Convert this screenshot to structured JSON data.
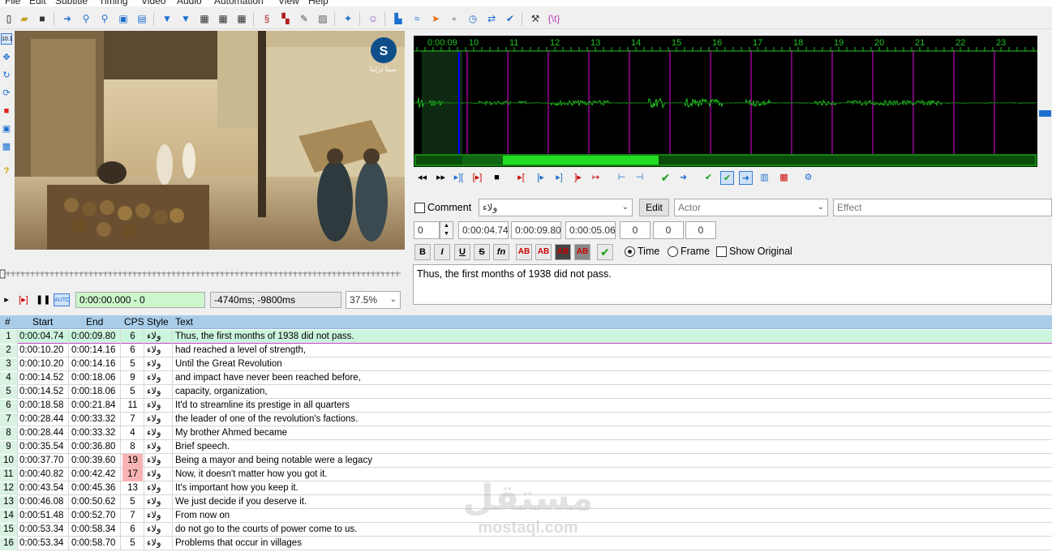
{
  "menu": [
    "File",
    "Edit",
    "Subtitle",
    "Timing",
    "Video",
    "Audio",
    "Automation",
    "View",
    "Help"
  ],
  "video": {
    "logo_text": "سما دراما",
    "position": "0:00:00.000 - 0",
    "offset": "-4740ms; -9800ms",
    "zoom": "37.5%"
  },
  "audio": {
    "time_labels": [
      "0:00:09",
      "10",
      "11",
      "12",
      "13",
      "14",
      "15",
      "16",
      "17",
      "18",
      "19",
      "20",
      "21",
      "22",
      "23"
    ],
    "colors": {
      "background": "#000000",
      "waveform": "#22c422",
      "boundary": "#e600e6",
      "cursor": "#0000ff"
    }
  },
  "editor": {
    "comment_label": "Comment",
    "style_value": "ولاء",
    "edit_label": "Edit",
    "actor_placeholder": "Actor",
    "effect_placeholder": "Effect",
    "layer": "0",
    "start": "0:00:04.74",
    "end": "0:00:09.80",
    "duration": "0:00:05.06",
    "margin_l": "0",
    "margin_r": "0",
    "margin_v": "0",
    "time_label": "Time",
    "frame_label": "Frame",
    "show_original_label": "Show Original",
    "text": "Thus, the first months of 1938 did not pass."
  },
  "grid": {
    "headers": {
      "num": "#",
      "start": "Start",
      "end": "End",
      "cps": "CPS",
      "style": "Style",
      "text": "Text"
    },
    "rows": [
      {
        "num": "1",
        "start": "0:00:04.74",
        "end": "0:00:09.80",
        "cps": "6",
        "style": "ولاء",
        "text": "Thus, the first months of 1938 did not pass."
      },
      {
        "num": "2",
        "start": "0:00:10.20",
        "end": "0:00:14.16",
        "cps": "6",
        "style": "ولاء",
        "text": " had reached a level of strength,"
      },
      {
        "num": "3",
        "start": "0:00:10.20",
        "end": "0:00:14.16",
        "cps": "5",
        "style": "ولاء",
        "text": "Until the Great Revolution"
      },
      {
        "num": "4",
        "start": "0:00:14.52",
        "end": "0:00:18.06",
        "cps": "9",
        "style": "ولاء",
        "text": "and impact have never been reached before,"
      },
      {
        "num": "5",
        "start": "0:00:14.52",
        "end": "0:00:18.06",
        "cps": "5",
        "style": "ولاء",
        "text": "capacity, organization,"
      },
      {
        "num": "6",
        "start": "0:00:18.58",
        "end": "0:00:21.84",
        "cps": "11",
        "style": "ولاء",
        "text": "It'd to streamline its prestige in all quarters"
      },
      {
        "num": "7",
        "start": "0:00:28.44",
        "end": "0:00:33.32",
        "cps": "7",
        "style": "ولاء",
        "text": "the leader of one of the revolution's factions."
      },
      {
        "num": "8",
        "start": "0:00:28.44",
        "end": "0:00:33.32",
        "cps": "4",
        "style": "ولاء",
        "text": "My brother Ahmed became"
      },
      {
        "num": "9",
        "start": "0:00:35.54",
        "end": "0:00:36.80",
        "cps": "8",
        "style": "ولاء",
        "text": "Brief speech."
      },
      {
        "num": "10",
        "start": "0:00:37.70",
        "end": "0:00:39.60",
        "cps": "19",
        "style": "ولاء",
        "text": "Being a mayor and being notable were a legacy"
      },
      {
        "num": "11",
        "start": "0:00:40.82",
        "end": "0:00:42.42",
        "cps": "17",
        "style": "ولاء",
        "text": "Now, it doesn't matter how you got it."
      },
      {
        "num": "12",
        "start": "0:00:43.54",
        "end": "0:00:45.36",
        "cps": "13",
        "style": "ولاء",
        "text": "It's important how you keep it."
      },
      {
        "num": "13",
        "start": "0:00:46.08",
        "end": "0:00:50.62",
        "cps": "5",
        "style": "ولاء",
        "text": "We just decide if you deserve it."
      },
      {
        "num": "14",
        "start": "0:00:51.48",
        "end": "0:00:52.70",
        "cps": "7",
        "style": "ولاء",
        "text": "From now on"
      },
      {
        "num": "15",
        "start": "0:00:53.34",
        "end": "0:00:58.34",
        "cps": "6",
        "style": "ولاء",
        "text": "do not go to the courts of power come to us."
      },
      {
        "num": "16",
        "start": "0:00:53.34",
        "end": "0:00:58.70",
        "cps": "5",
        "style": "ولاء",
        "text": "Problems that occur in villages"
      }
    ]
  },
  "watermark": {
    "arabic": "مستقل",
    "latin": "mostaql.com"
  }
}
